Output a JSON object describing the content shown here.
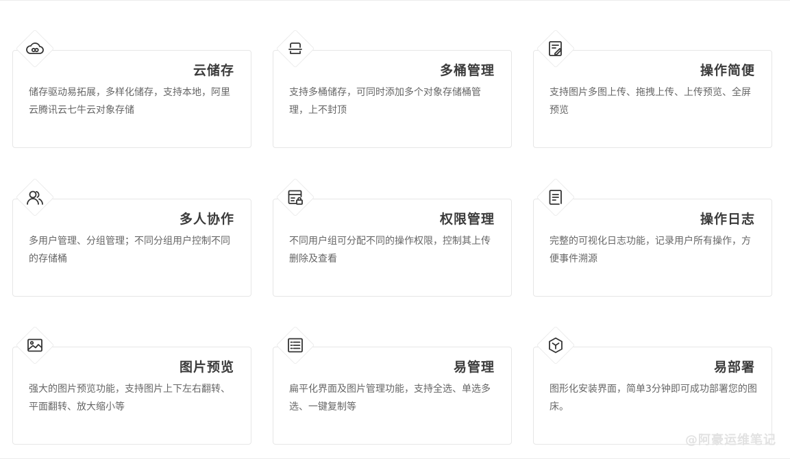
{
  "features": [
    {
      "title": "云储存",
      "desc": "储存驱动易拓展，多样化储存，支持本地，阿里云腾讯云七牛云对象存储",
      "icon": "cloud-icon"
    },
    {
      "title": "多桶管理",
      "desc": "支持多桶储存，可同时添加多个对象存储桶管理，上不封顶",
      "icon": "bucket-stack-icon"
    },
    {
      "title": "操作简便",
      "desc": "支持图片多图上传、拖拽上传、上传预览、全屏预览",
      "icon": "edit-document-icon"
    },
    {
      "title": "多人协作",
      "desc": "多用户管理、分组管理；不同分组用户控制不同的存储桶",
      "icon": "users-icon"
    },
    {
      "title": "权限管理",
      "desc": "不同用户组可分配不同的操作权限，控制其上传删除及查看",
      "icon": "lock-panel-icon"
    },
    {
      "title": "操作日志",
      "desc": "完整的可视化日志功能，记录用户所有操作，方便事件溯源",
      "icon": "log-document-icon"
    },
    {
      "title": "图片预览",
      "desc": "强大的图片预览功能，支持图片上下左右翻转、平面翻转、放大缩小等",
      "icon": "image-icon"
    },
    {
      "title": "易管理",
      "desc": "扁平化界面及图片管理功能，支持全选、单选多选、一键复制等",
      "icon": "list-icon"
    },
    {
      "title": "易部署",
      "desc": "图形化安装界面，简单3分钟即可成功部署您的图床。",
      "icon": "cube-icon"
    }
  ],
  "watermark": "@阿豪运维笔记",
  "colors": {
    "icon": "#333333",
    "title": "#3b3b3b",
    "text": "#666666",
    "border": "#e6e6e6"
  }
}
